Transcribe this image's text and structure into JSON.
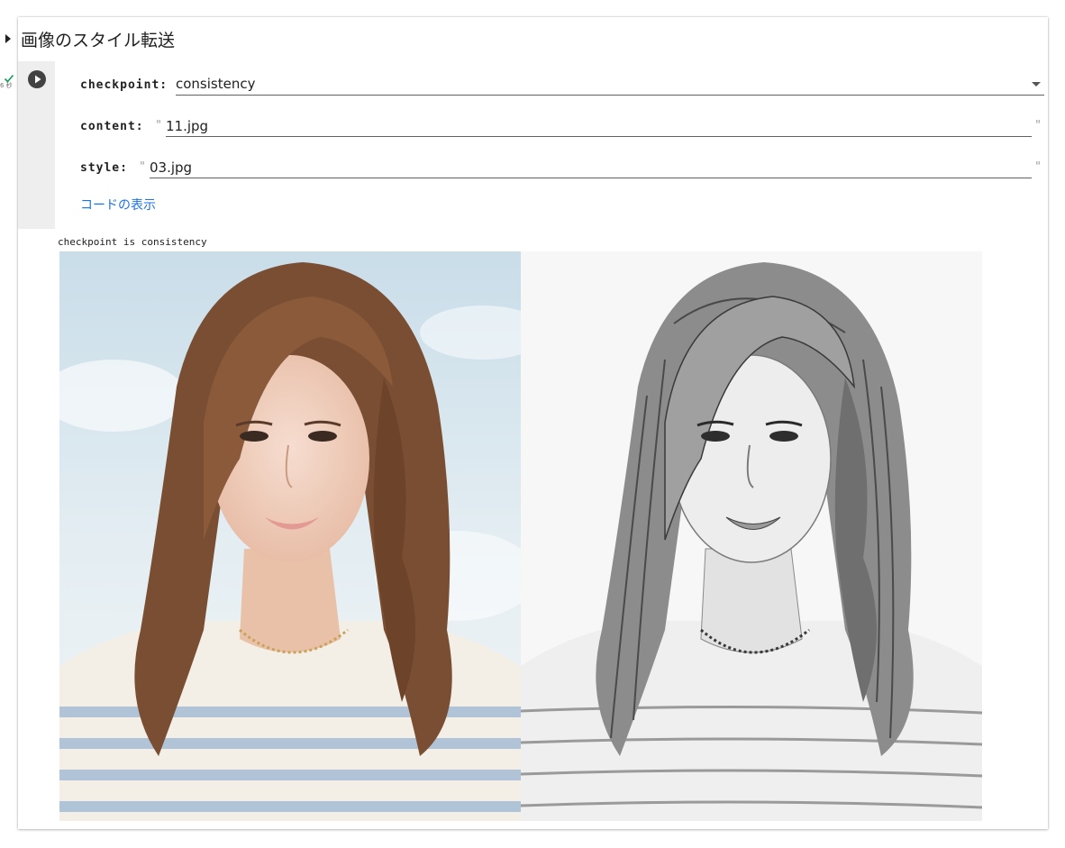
{
  "cell": {
    "section_title": "画像のスタイル転送",
    "exec_time": "6 秒",
    "icons": {
      "collapse": "caret-right-icon",
      "status": "check-icon",
      "run": "play-icon"
    },
    "form": {
      "checkpoint": {
        "label": "checkpoint:",
        "value": "consistency"
      },
      "content": {
        "label": "content:",
        "value": "11.jpg"
      },
      "style": {
        "label": "style:",
        "value": "03.jpg"
      },
      "quote": "\""
    },
    "show_code_link": "コードの表示",
    "output": {
      "text": "checkpoint is consistency",
      "images": [
        "content-photo",
        "stylized-sketch"
      ]
    }
  },
  "colors": {
    "link": "#1a73e8",
    "run_button": "#424242",
    "status_check": "#0f9d58",
    "gutter_bg": "#eeeeee"
  }
}
